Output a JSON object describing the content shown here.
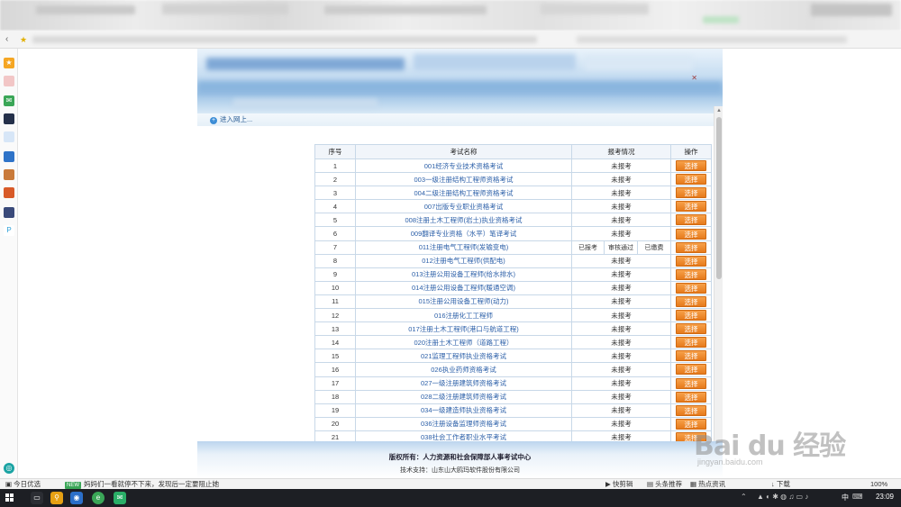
{
  "nav": {
    "entry_label": "进入网上..."
  },
  "table": {
    "headers": {
      "index": "序号",
      "name": "考试名称",
      "status": "报考情况",
      "action": "操作"
    },
    "button_label": "选择",
    "rows": [
      {
        "index": "1",
        "name": "001经济专业技术资格考试",
        "status": "未报考"
      },
      {
        "index": "2",
        "name": "003一级注册结构工程师资格考试",
        "status": "未报考"
      },
      {
        "index": "3",
        "name": "004二级注册结构工程师资格考试",
        "status": "未报考"
      },
      {
        "index": "4",
        "name": "007出版专业职业资格考试",
        "status": "未报考"
      },
      {
        "index": "5",
        "name": "008注册土木工程师(岩土)执业资格考试",
        "status": "未报考"
      },
      {
        "index": "6",
        "name": "009翻译专业资格（水平）笔译考试",
        "status": "未报考"
      },
      {
        "index": "7",
        "name": "011注册电气工程师(发输变电)",
        "status": "",
        "sub": [
          "已报考",
          "审核通过",
          "已缴费"
        ]
      },
      {
        "index": "8",
        "name": "012注册电气工程师(供配电)",
        "status": "未报考"
      },
      {
        "index": "9",
        "name": "013注册公用设备工程师(给水排水)",
        "status": "未报考"
      },
      {
        "index": "10",
        "name": "014注册公用设备工程师(暖通空调)",
        "status": "未报考"
      },
      {
        "index": "11",
        "name": "015注册公用设备工程师(动力)",
        "status": "未报考"
      },
      {
        "index": "12",
        "name": "016注册化工工程师",
        "status": "未报考"
      },
      {
        "index": "13",
        "name": "017注册土木工程师(港口与航道工程)",
        "status": "未报考"
      },
      {
        "index": "14",
        "name": "020注册土木工程师（道路工程）",
        "status": "未报考"
      },
      {
        "index": "15",
        "name": "021监理工程师执业资格考试",
        "status": "未报考"
      },
      {
        "index": "16",
        "name": "026执业药师资格考试",
        "status": "未报考"
      },
      {
        "index": "17",
        "name": "027一级注册建筑师资格考试",
        "status": "未报考"
      },
      {
        "index": "18",
        "name": "028二级注册建筑师资格考试",
        "status": "未报考"
      },
      {
        "index": "19",
        "name": "034一级建造师执业资格考试",
        "status": "未报考"
      },
      {
        "index": "20",
        "name": "036注册设备监理师资格考试",
        "status": "未报考"
      },
      {
        "index": "21",
        "name": "038社会工作者职业水平考试",
        "status": "未报考"
      }
    ]
  },
  "footer": {
    "copyright": "版权所有：人力资源和社会保障部人事考试中心",
    "support": "技术支持：山东山大鸥玛软件股份有限公司"
  },
  "watermark": {
    "main": "Bai du 经验",
    "sub": "jingyan.baidu.com"
  },
  "statusbar": {
    "left1": "今日优选",
    "news_badge": "NEW",
    "news_text": "妈妈们一看就停不下来，发现后一定要阻止她",
    "right1": "快剪辑",
    "right2": "头条推荐",
    "right3": "热点资讯",
    "right4": "下载",
    "zoom": "100%"
  },
  "taskbar": {
    "lang": "中",
    "time": "23:09"
  },
  "colors": {
    "button_orange": "#ee8b2f",
    "link_blue": "#2b5fa8",
    "header_blue": "#9fc4e6"
  }
}
